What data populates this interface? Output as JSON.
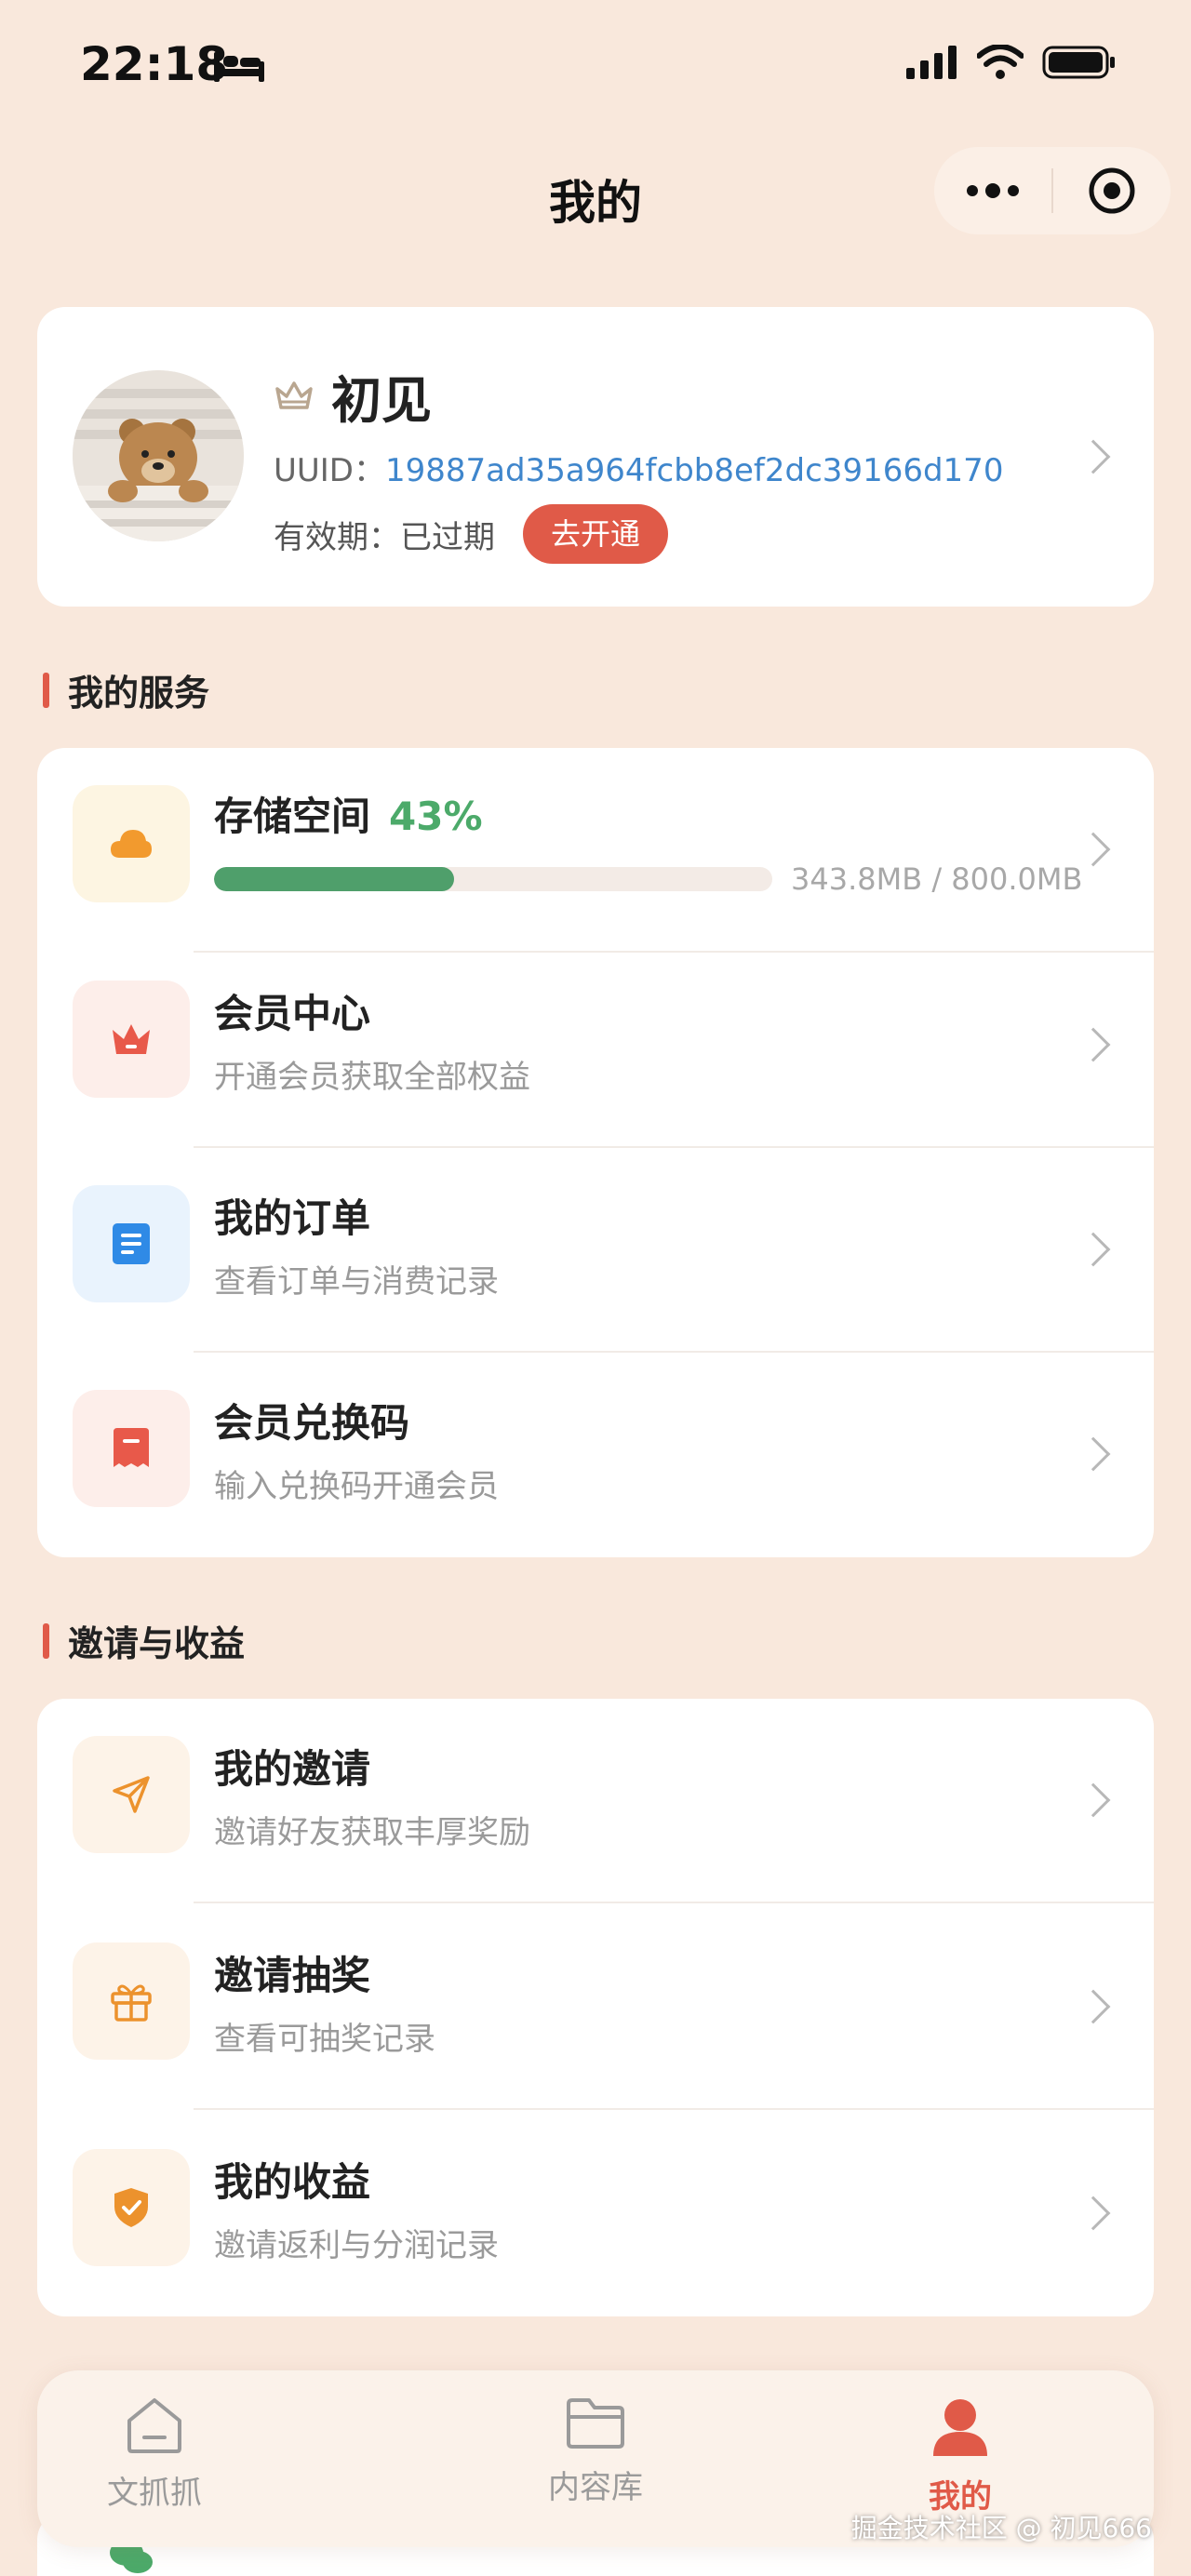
{
  "status_bar": {
    "time": "22:18"
  },
  "nav": {
    "title": "我的"
  },
  "profile": {
    "nickname": "初见",
    "uuid_label": "UUID：",
    "uuid_value": "19887ad35a964fcbb8ef2dc39166d170",
    "expire_label": "有效期：",
    "expire_value": "已过期",
    "open_button": "去开通"
  },
  "services": {
    "section_title": "我的服务",
    "storage": {
      "title": "存储空间",
      "percent_text": "43%",
      "progress": 0.43,
      "used_text": "343.8MB / 800.0MB"
    },
    "items": [
      {
        "title": "会员中心",
        "subtitle": "开通会员获取全部权益",
        "icon": "crown-icon"
      },
      {
        "title": "我的订单",
        "subtitle": "查看订单与消费记录",
        "icon": "document-icon"
      },
      {
        "title": "会员兑换码",
        "subtitle": "输入兑换码开通会员",
        "icon": "receipt-icon"
      }
    ]
  },
  "invite": {
    "section_title": "邀请与收益",
    "items": [
      {
        "title": "我的邀请",
        "subtitle": "邀请好友获取丰厚奖励",
        "icon": "send-icon"
      },
      {
        "title": "邀请抽奖",
        "subtitle": "查看可抽奖记录",
        "icon": "gift-icon"
      },
      {
        "title": "我的收益",
        "subtitle": "邀请返利与分润记录",
        "icon": "shield-icon"
      }
    ]
  },
  "tabbar": {
    "tabs": [
      {
        "label": "文抓抓",
        "icon": "home-icon"
      },
      {
        "label": "内容库",
        "icon": "folder-icon"
      },
      {
        "label": "我的",
        "icon": "user-icon"
      }
    ]
  },
  "watermark": "掘金技术社区 @ 初见666",
  "colors": {
    "accent": "#e05a48",
    "background": "#f9e8dc",
    "link": "#3f86cc",
    "success": "#4caa6a"
  }
}
